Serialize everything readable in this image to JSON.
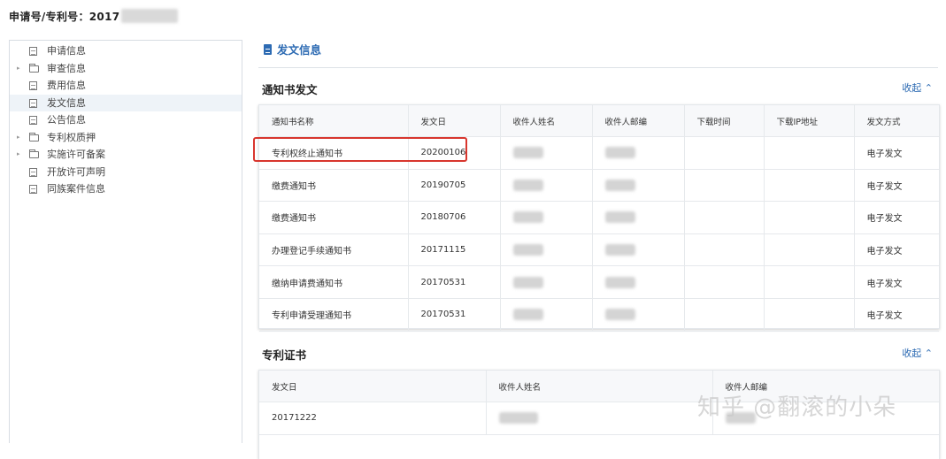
{
  "header": {
    "title": "申请号/专利号：2017"
  },
  "sidebar": {
    "items": [
      {
        "label": "申请信息",
        "icon": "document-icon",
        "caret": ""
      },
      {
        "label": "审查信息",
        "icon": "folder-icon",
        "caret": "▸"
      },
      {
        "label": "费用信息",
        "icon": "document-icon",
        "caret": ""
      },
      {
        "label": "发文信息",
        "icon": "document-icon",
        "caret": ""
      },
      {
        "label": "公告信息",
        "icon": "document-icon",
        "caret": ""
      },
      {
        "label": "专利权质押",
        "icon": "folder-icon",
        "caret": "▸"
      },
      {
        "label": "实施许可备案",
        "icon": "folder-icon",
        "caret": "▸"
      },
      {
        "label": "开放许可声明",
        "icon": "document-icon",
        "caret": ""
      },
      {
        "label": "同族案件信息",
        "icon": "document-icon",
        "caret": ""
      }
    ]
  },
  "main": {
    "heading": "发文信息",
    "notices": {
      "title": "通知书发文",
      "collapse_label": "收起 ⌃",
      "columns": [
        "通知书名称",
        "发文日",
        "收件人姓名",
        "收件人邮编",
        "下载时间",
        "下载IP地址",
        "发文方式"
      ],
      "rows": [
        {
          "name": "专利权终止通知书",
          "date": "20200106",
          "method": "电子发文"
        },
        {
          "name": "缴费通知书",
          "date": "20190705",
          "method": "电子发文"
        },
        {
          "name": "缴费通知书",
          "date": "20180706",
          "method": "电子发文"
        },
        {
          "name": "办理登记手续通知书",
          "date": "20171115",
          "method": "电子发文"
        },
        {
          "name": "缴纳申请费通知书",
          "date": "20170531",
          "method": "电子发文"
        },
        {
          "name": "专利申请受理通知书",
          "date": "20170531",
          "method": "电子发文"
        }
      ]
    },
    "certificate": {
      "title": "专利证书",
      "collapse_label": "收起 ⌃",
      "columns": [
        "发文日",
        "收件人姓名",
        "收件人邮编"
      ],
      "rows": [
        {
          "date": "20171222"
        }
      ]
    }
  },
  "watermark": "知乎 @翻滚的小朵",
  "colors": {
    "accent": "#2d6bb3",
    "highlight": "#d8362e",
    "selected_bg": "#eef3f8"
  }
}
